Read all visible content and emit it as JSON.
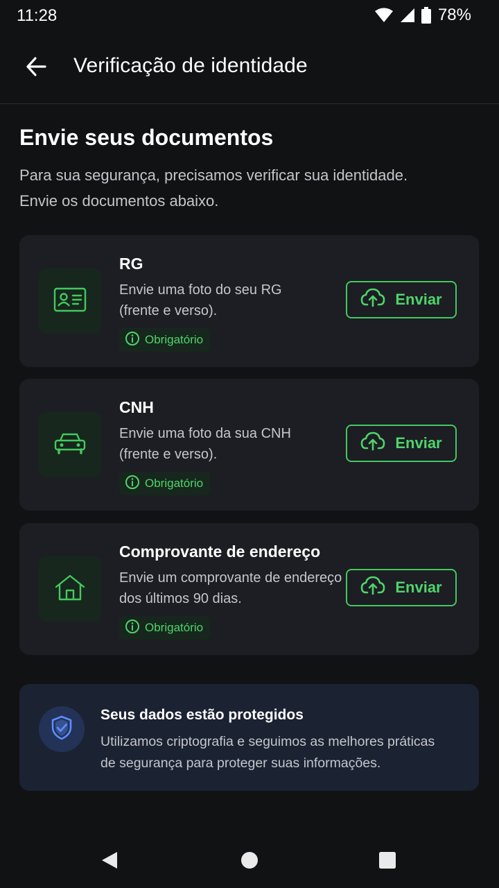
{
  "status_bar": {
    "time": "11:28",
    "battery": "78%"
  },
  "app_bar": {
    "title": "Verificação de identidade"
  },
  "intro": {
    "title": "Envie seus documentos",
    "description_line1": "Para sua segurança, precisamos verificar sua identidade.",
    "description_line2": "Envie os documentos abaixo."
  },
  "documents": [
    {
      "icon": "id-card-icon",
      "title": "RG",
      "desc_line1": "Envie uma foto do seu RG",
      "desc_line2": "(frente e verso).",
      "badge": "Obrigatório",
      "button": "Enviar"
    },
    {
      "icon": "car-icon",
      "title": "CNH",
      "desc_line1": "Envie uma foto da sua CNH",
      "desc_line2": "(frente e verso).",
      "badge": "Obrigatório",
      "button": "Enviar"
    },
    {
      "icon": "house-icon",
      "title": "Comprovante de endereço",
      "desc_line1": "Envie um comprovante de endereço",
      "desc_line2": "dos últimos 90 dias.",
      "badge": "Obrigatório",
      "button": "Enviar"
    }
  ],
  "security": {
    "title": "Seus dados estão protegidos",
    "desc_line1": "Utilizamos criptografia e seguimos as melhores práticas",
    "desc_line2": "de segurança para proteger suas informações."
  },
  "colors": {
    "background": "#111214",
    "card": "#1c1e23",
    "accent_green": "#4fd46b",
    "security_card": "#1b2232",
    "shield_blue": "#5b8dff"
  }
}
